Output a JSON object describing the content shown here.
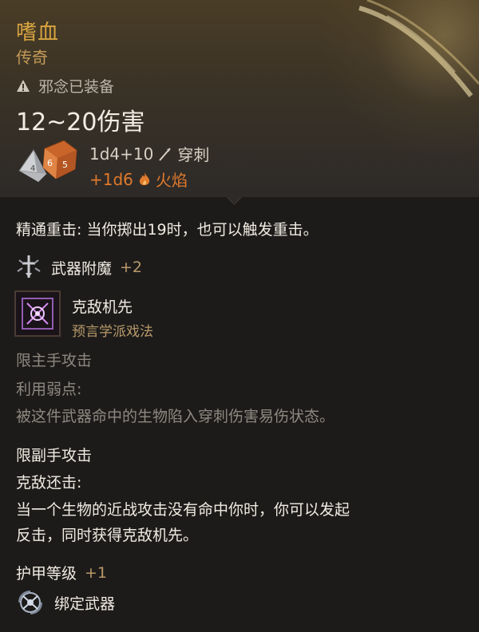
{
  "item": {
    "name": "嗜血",
    "rarity": "传奇",
    "equipped_status": "邪念已装备",
    "damage_range": "12~20伤害",
    "damage_roll": "1d4+10",
    "damage_type": "穿刺",
    "bonus_roll": "+1d6",
    "bonus_type": "火焰"
  },
  "properties": {
    "crit_line": "精通重击: 当你掷出19时，也可以触发重击。",
    "enchant_label": "武器附魔",
    "enchant_value": "+2",
    "spell_name": "克敌机先",
    "spell_school": "预言学派戏法",
    "main_hand_only": "限主手攻击",
    "weakness_title": "利用弱点:",
    "weakness_desc": "被这件武器命中的生物陷入穿刺伤害易伤状态。",
    "off_hand_only": "限副手攻击",
    "riposte_title": "克敌还击:",
    "riposte_desc_1": "当一个生物的近战攻击没有命中你时，你可以发起",
    "riposte_desc_2": "反击，同时获得克敌机先。",
    "armor_label": "护甲等级",
    "armor_value": "+1",
    "bound_label": "绑定武器"
  },
  "colors": {
    "title": "#d9a441",
    "fire": "#e07a2c",
    "muted": "#8e8880"
  },
  "icons": [
    "warning-icon",
    "dice-icon",
    "piercing-icon",
    "fire-icon",
    "enchant-icon",
    "spell-icon",
    "bound-weapon-icon"
  ]
}
